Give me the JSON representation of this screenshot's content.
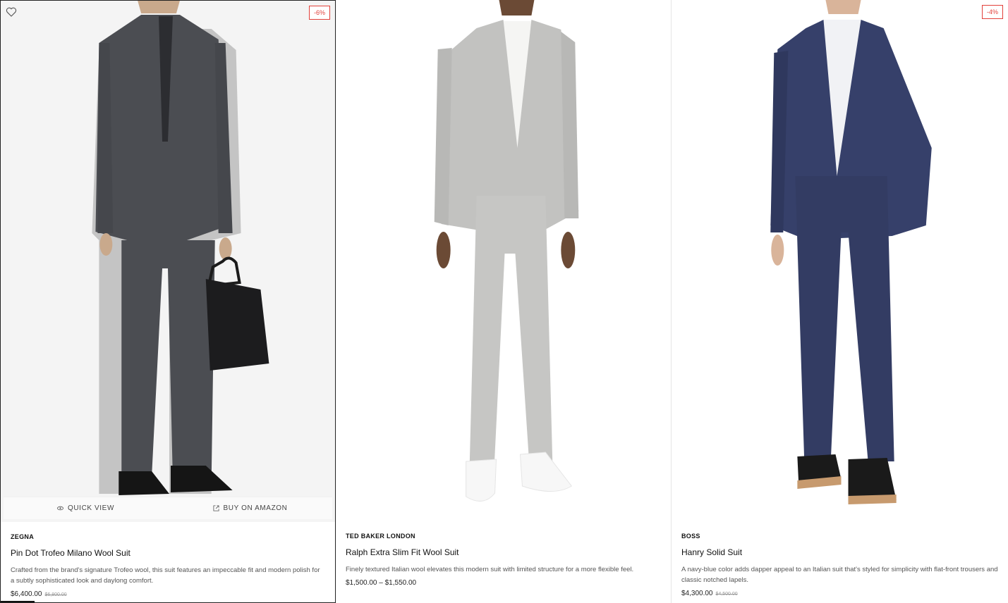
{
  "colors": {
    "accent": "#e2403a",
    "text": "#111111",
    "muted": "#555555",
    "border": "#e6e6e6"
  },
  "products": [
    {
      "brand": "ZEGNA",
      "name": "Pin Dot Trofeo Milano Wool Suit",
      "description": "Crafted from the brand's signature Trofeo wool, this suit features an impeccable fit and modern polish for a subtly sophisticated look and daylong comfort.",
      "price": "$6,400.00",
      "old_price": "$6,800.00",
      "badge": "-6%",
      "wishlist_icon": "heart-outline-icon",
      "quick_view": "QUICK VIEW",
      "buy": "BUY ON AMAZON",
      "suit_color": "#4b4d52"
    },
    {
      "brand": "TED BAKER LONDON",
      "name": "Ralph Extra Slim Fit Wool Suit",
      "description": "Finely textured Italian wool elevates this modern suit with limited structure for a more flexible feel.",
      "price": "$1,500.00 – $1,550.00",
      "suit_color": "#c2c2c0"
    },
    {
      "brand": "BOSS",
      "name": "Hanry Solid Suit",
      "description": "A navy-blue color adds dapper appeal to an Italian suit that's styled for simplicity with flat-front trousers and classic notched lapels.",
      "price": "$4,300.00",
      "old_price": "$4,500.00",
      "badge": "-4%",
      "suit_color": "#36406a"
    }
  ]
}
